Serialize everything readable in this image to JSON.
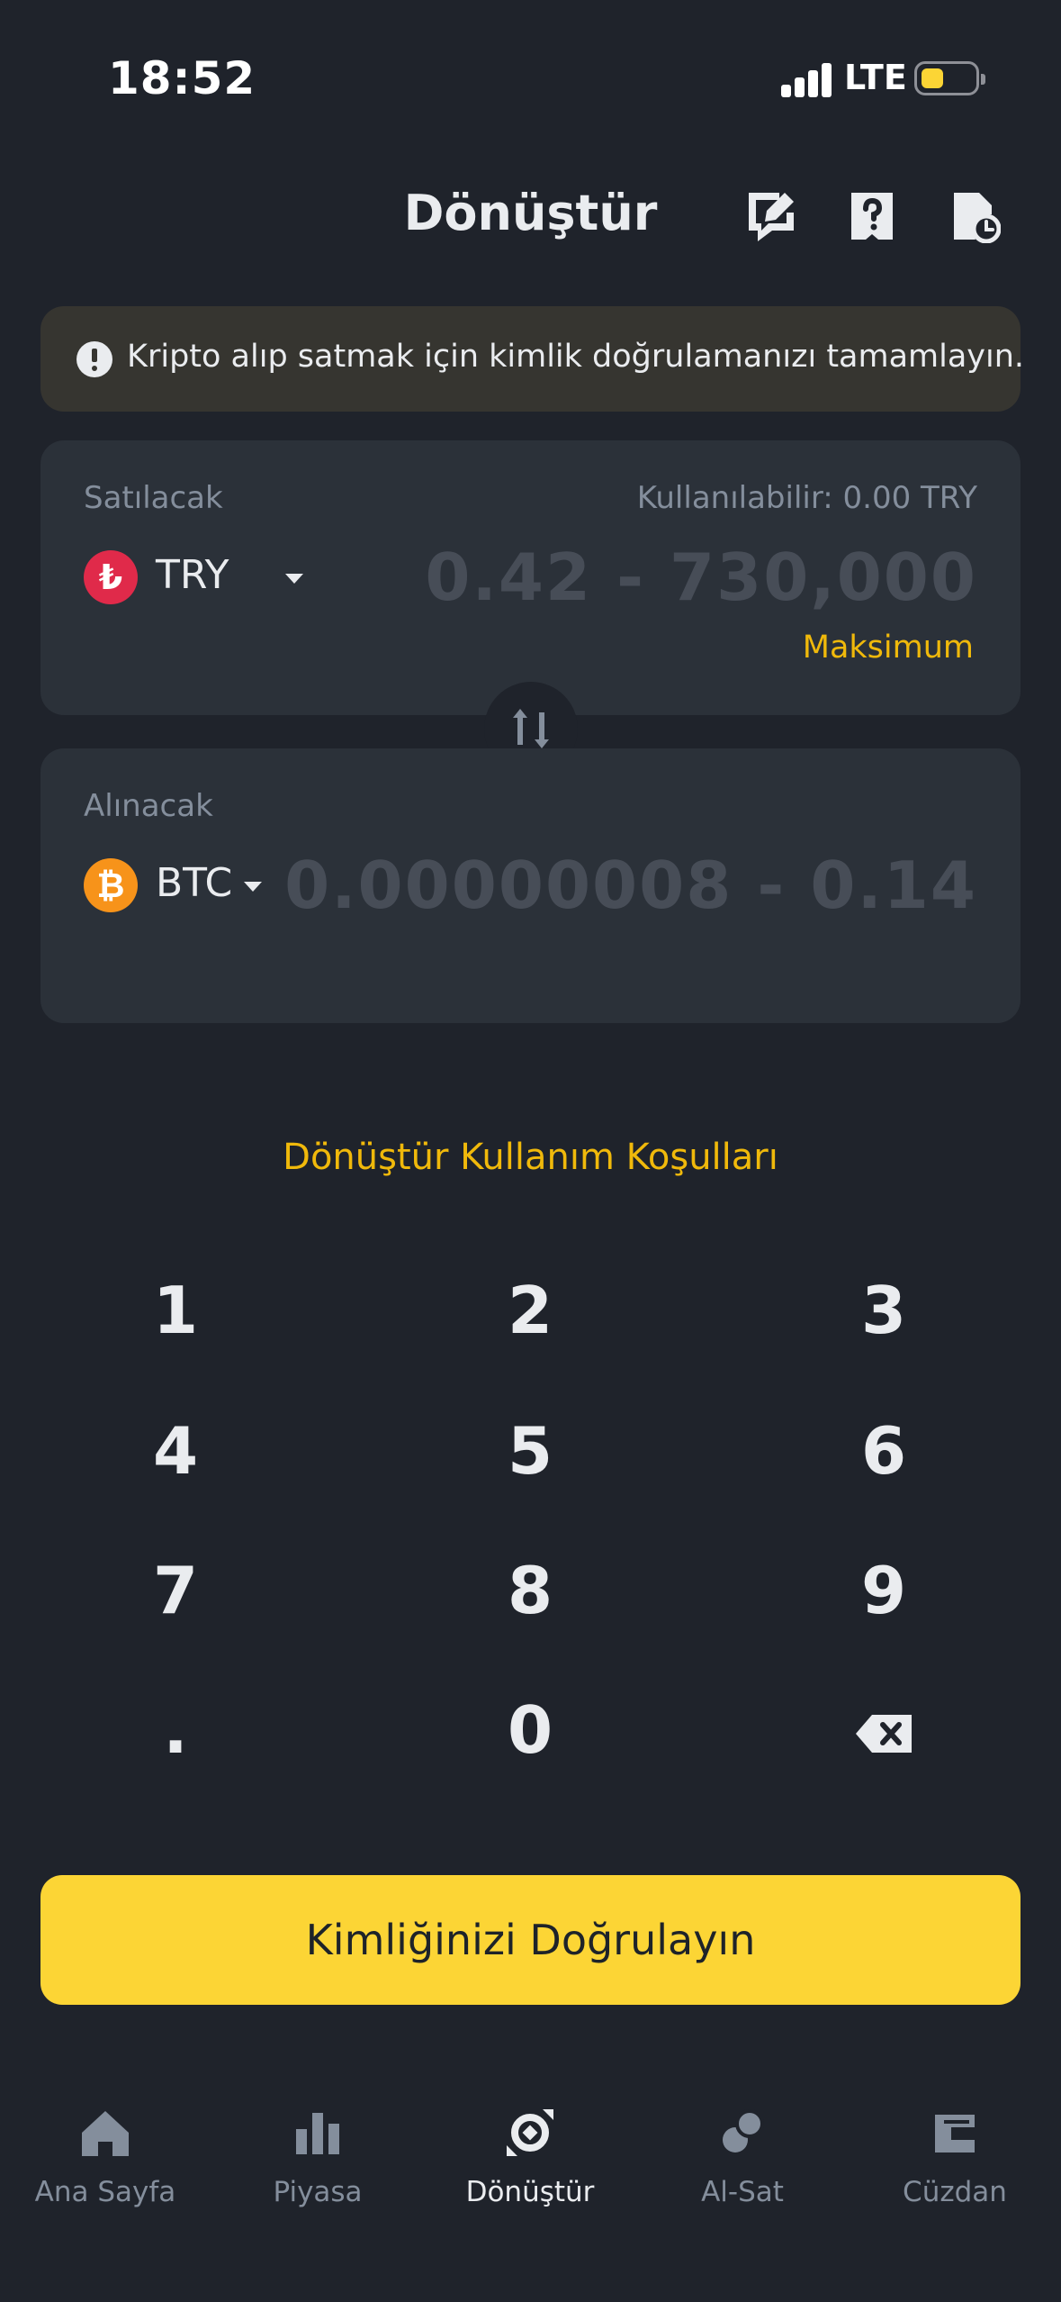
{
  "status_bar": {
    "time": "18:52",
    "network": "LTE"
  },
  "header": {
    "title": "Dönüştür"
  },
  "alert": {
    "text": "Kripto alıp satmak için kimlik doğrulamanızı tamamlayın."
  },
  "sell": {
    "label": "Satılacak",
    "available": "Kullanılabilir: 0.00 TRY",
    "currency": "TRY",
    "currency_symbol": "₺",
    "currency_color": "#e02a4a",
    "amount_placeholder": "0.42 - 730,000",
    "max_label": "Maksimum"
  },
  "buy": {
    "label": "Alınacak",
    "currency": "BTC",
    "currency_symbol": "₿",
    "currency_color": "#f7931a",
    "amount_placeholder": "0.00000008 - 0.14"
  },
  "terms_link": "Dönüştür Kullanım Koşulları",
  "keypad": {
    "k1": "1",
    "k2": "2",
    "k3": "3",
    "k4": "4",
    "k5": "5",
    "k6": "6",
    "k7": "7",
    "k8": "8",
    "k9": "9",
    "dot": ".",
    "k0": "0"
  },
  "primary_button": "Kimliğinizi Doğrulayın",
  "bottom_nav": {
    "home": "Ana Sayfa",
    "markets": "Piyasa",
    "convert": "Dönüştür",
    "trade": "Al-Sat",
    "wallet": "Cüzdan"
  },
  "colors": {
    "accent": "#f0b90b",
    "button": "#fcd535",
    "background": "#1f232b",
    "card": "#2b3139"
  }
}
